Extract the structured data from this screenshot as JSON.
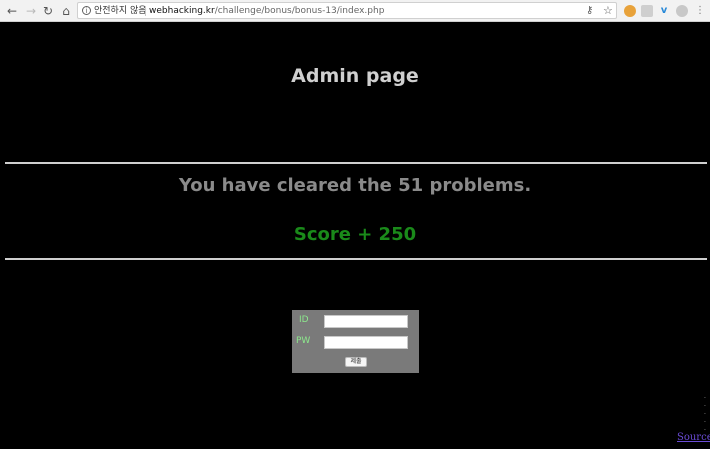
{
  "browser": {
    "security_label": "안전하지 않음",
    "url_host": "webhacking.kr",
    "url_path": "/challenge/bonus/bonus-13/index.php"
  },
  "page": {
    "title": "Admin page",
    "cleared_message": "You have cleared the 51 problems.",
    "score_message": "Score + 250"
  },
  "login_form": {
    "id_label": "ID",
    "pw_label": "PW",
    "id_value": "",
    "pw_value": "",
    "submit_label": "제출"
  },
  "footer": {
    "source_link": "Source"
  },
  "colors": {
    "background": "#000000",
    "title": "#d0d0d0",
    "cleared_text": "#8a8a8a",
    "score_text": "#1a8a1a",
    "form_bg": "#7a7a7a",
    "form_labels": "#8de88d",
    "link": "#6a4bd6"
  }
}
